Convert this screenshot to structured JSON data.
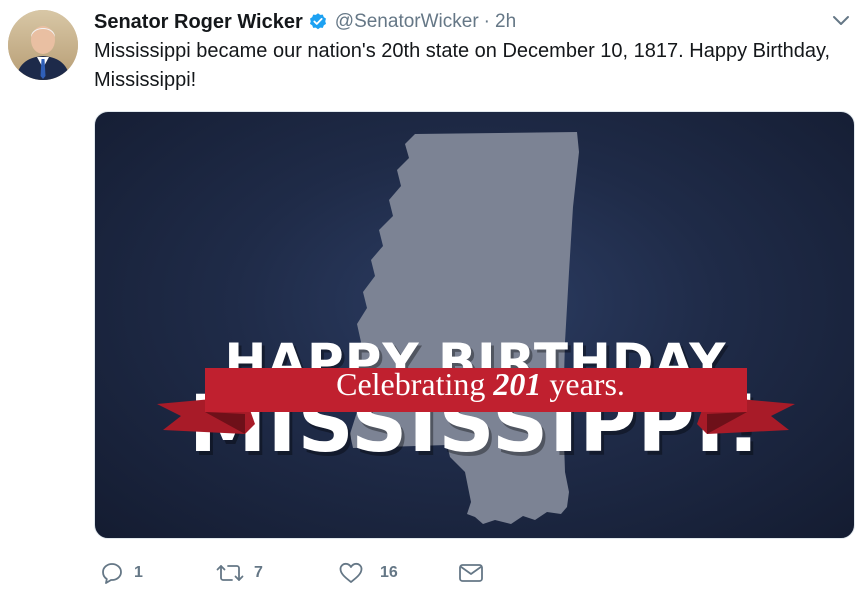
{
  "tweet": {
    "display_name": "Senator Roger Wicker",
    "verified": true,
    "handle": "@SenatorWicker",
    "separator": "·",
    "time": "2h",
    "text": "Mississippi became our nation's 20th state on December 10, 1817. Happy Birthday, Mississippi!",
    "more_icon": "chevron-down-icon"
  },
  "media": {
    "headline_1": "HAPPY BIRTHDAY",
    "headline_2": "MISSISSIPPI!",
    "banner_prefix": "Celebrating ",
    "banner_number": "201",
    "banner_suffix": " years.",
    "colors": {
      "background": "#1f2b48",
      "state_shape": "#7c8394",
      "banner_red": "#c0202f"
    }
  },
  "actions": {
    "reply": {
      "icon": "reply-icon",
      "count": "1"
    },
    "retweet": {
      "icon": "retweet-icon",
      "count": "7"
    },
    "like": {
      "icon": "heart-icon",
      "count": "16"
    },
    "message": {
      "icon": "envelope-icon"
    }
  },
  "colors": {
    "text": "#14171a",
    "muted": "#657786",
    "verified": "#1da1f2"
  }
}
